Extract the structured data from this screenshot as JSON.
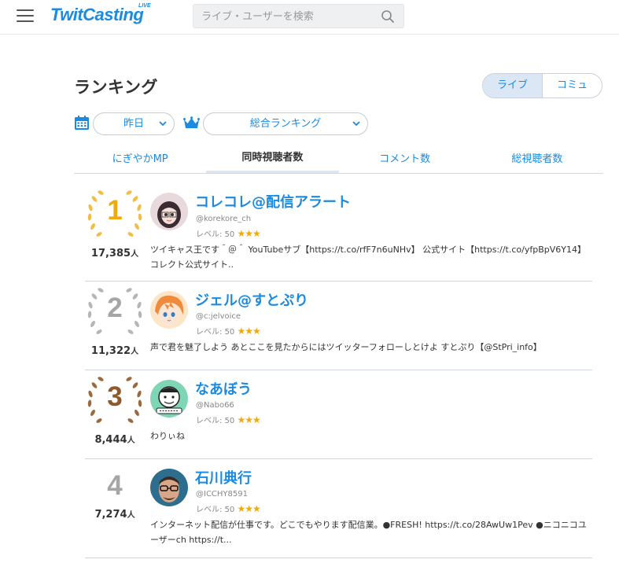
{
  "header": {
    "logo": "TwitCasting",
    "logo_badge": "LIVE",
    "search_placeholder": "ライブ・ユーザーを検索"
  },
  "page": {
    "title": "ランキング",
    "segment": [
      "ライブ",
      "コミュ"
    ]
  },
  "filters": {
    "day": "昨日",
    "type": "総合ランキング"
  },
  "tabs": [
    "にぎやかMP",
    "同時視聴者数",
    "コメント数",
    "総視聴者数"
  ],
  "colors": {
    "accent": "#1a8be0",
    "gold": "#f0a90f",
    "silver": "#a6a6a6",
    "bronze": "#8c5a2b"
  },
  "rankings": [
    {
      "rank": "1",
      "viewers": "17,385",
      "unit": "人",
      "name": "コレコレ@配信アラート",
      "id": "@korekore_ch",
      "level": "レベル: 50",
      "stars": "★★★",
      "comment": "ツイキャス王です＾＠＾ YouTubeサブ【https://t.co/rfF7n6uNHv】 公式サイト【https://t.co/yfpBpV6Y14】コレクト公式サイト..",
      "avatar_icon": "anime-girl-avatar"
    },
    {
      "rank": "2",
      "viewers": "11,322",
      "unit": "人",
      "name": "ジェル@すとぷり",
      "id": "@c:jelvoice",
      "level": "レベル: 50",
      "stars": "★★★",
      "comment": "声で君を魅了しよう あとここを見たからにはツイッターフォローしとけよ すとぷり【@StPri_info】",
      "avatar_icon": "orange-hair-avatar"
    },
    {
      "rank": "3",
      "viewers": "8,444",
      "unit": "人",
      "name": "なあぼう",
      "id": "@Nabo66",
      "level": "レベル: 50",
      "stars": "★★★",
      "comment": "わりぃね",
      "avatar_icon": "cartoon-face-avatar"
    },
    {
      "rank": "4",
      "viewers": "7,274",
      "unit": "人",
      "name": "石川典行",
      "id": "@ICCHY8591",
      "level": "レベル: 50",
      "stars": "★★★",
      "comment": "インターネット配信が仕事です。どこでもやります配信業。●FRESH! https://t.co/28AwUw1Pev ●ニコニコユーザーch https://t...",
      "avatar_icon": "man-glasses-avatar"
    }
  ]
}
